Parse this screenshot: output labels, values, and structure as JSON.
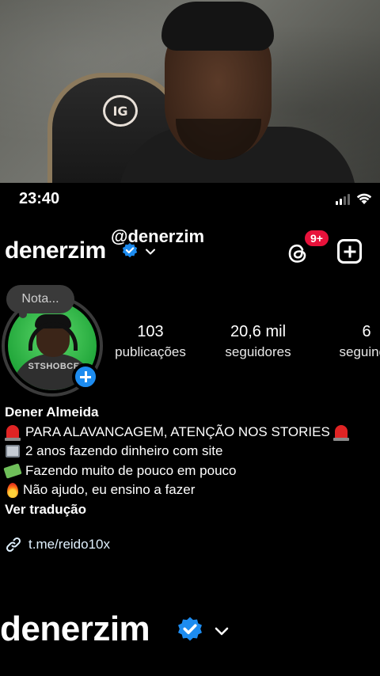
{
  "status_bar": {
    "time": "23:40"
  },
  "profile": {
    "username": "denerzim",
    "overlay_handle": "@denerzim",
    "threads_badge": "9+",
    "note_text": "Nota...",
    "avatar_shirt_text": "STSHOBCE"
  },
  "stats": [
    {
      "value": "103",
      "label": "publicações"
    },
    {
      "value": "20,6 mil",
      "label": "seguidores"
    },
    {
      "value": "6",
      "label": "seguindo"
    }
  ],
  "bio": {
    "name": "Dener Almeida",
    "lines": [
      "PARA ALAVANCAGEM, ATENÇÃO NOS STORIES",
      "2 anos fazendo dinheiro com site",
      "Fazendo muito de pouco em pouco",
      "Não ajudo, eu ensino a fazer"
    ],
    "see_translation": "Ver tradução",
    "link": "t.me/reido10x"
  },
  "caption": {
    "username": "denerzim"
  },
  "colors": {
    "verified": "#1d8cf0",
    "badge": "#e8123b",
    "background": "#000000"
  },
  "icons": [
    "verified-icon",
    "chevron-down-icon",
    "threads-icon",
    "add-icon",
    "link-icon",
    "signal-icon",
    "wifi-icon"
  ]
}
